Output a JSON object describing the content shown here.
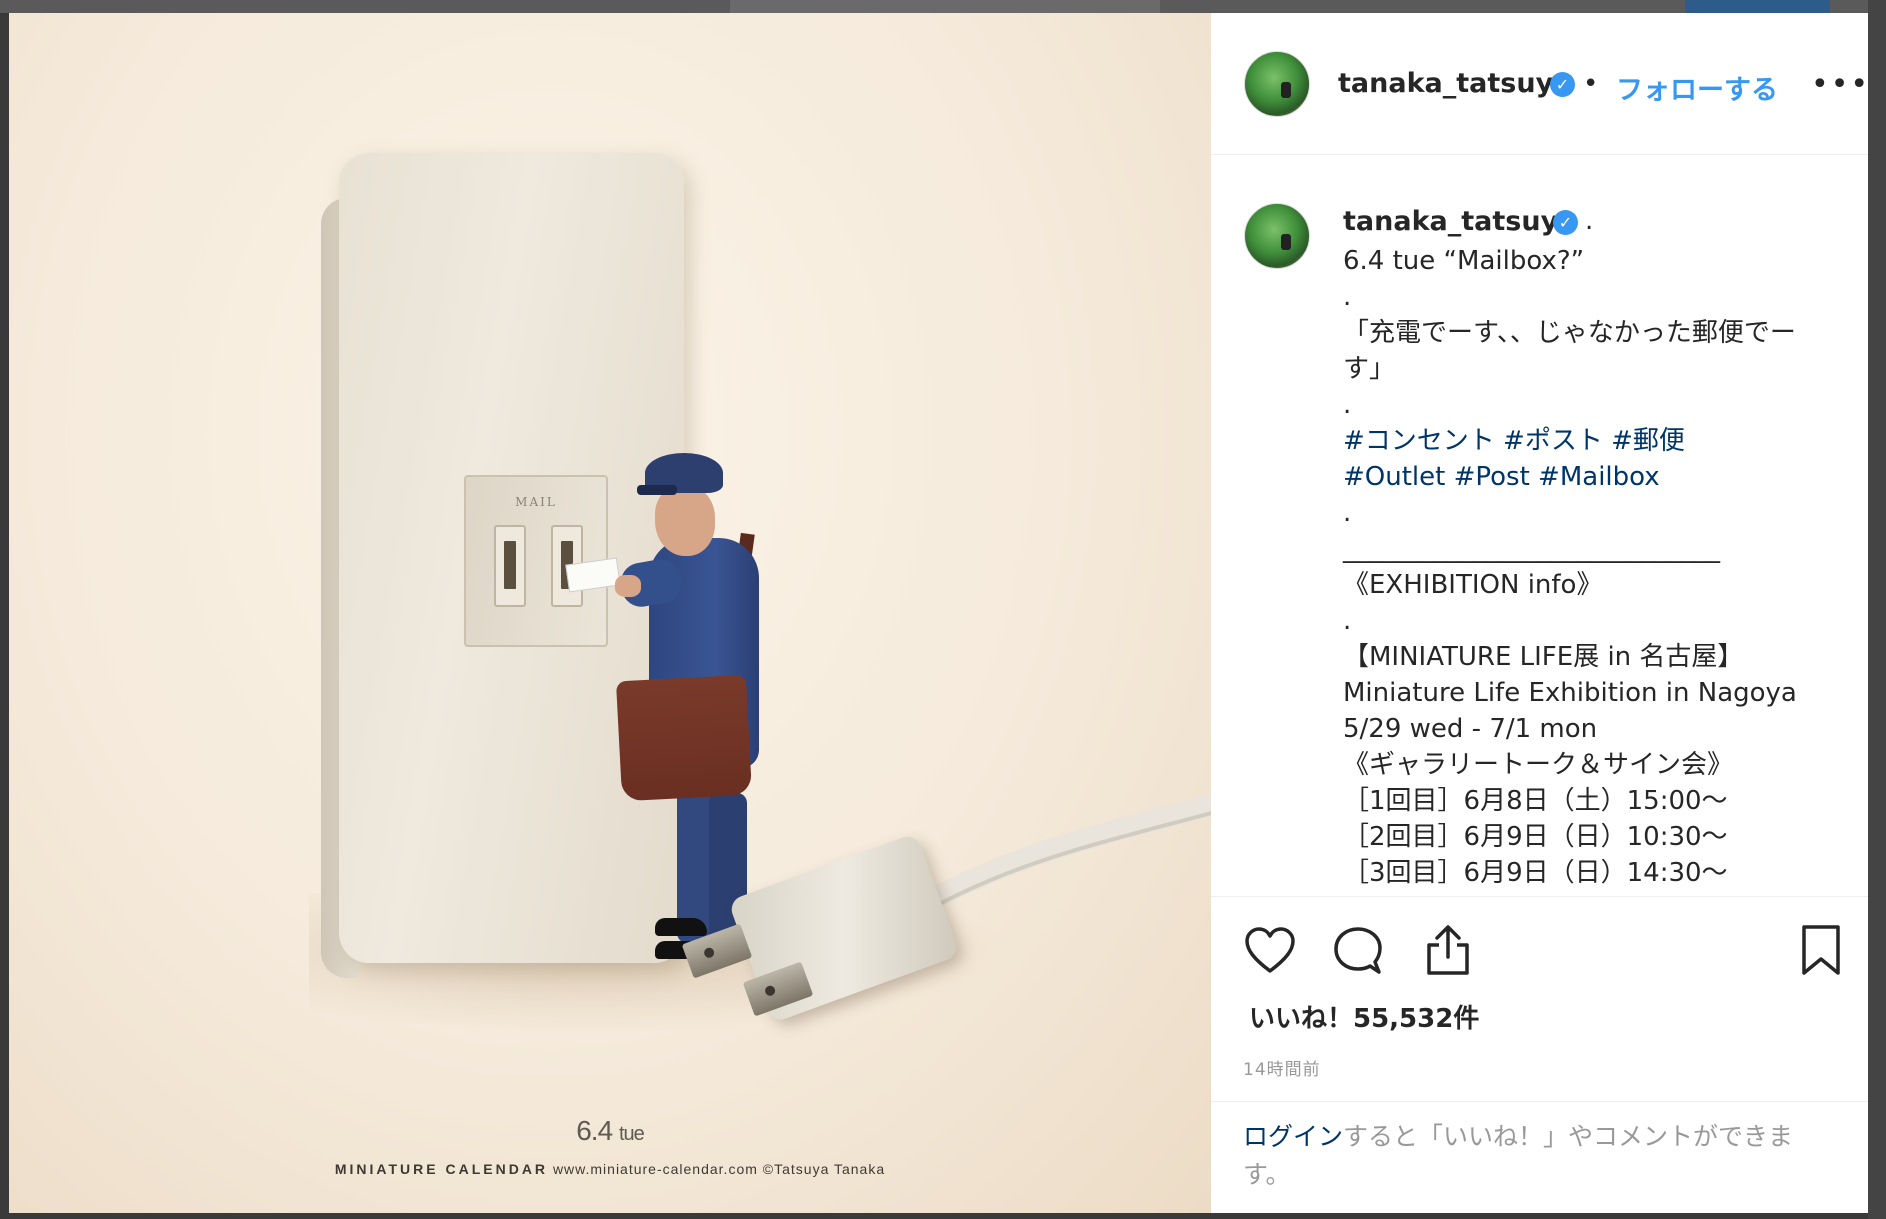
{
  "photo": {
    "outlet_label": "MAIL",
    "calendar_date": "6.4",
    "calendar_day": "tue",
    "calendar_brand": "MINIATURE CALENDAR",
    "calendar_credit": "www.miniature-calendar.com ©Tatsuya Tanaka"
  },
  "header": {
    "username": "tanaka_tatsuya",
    "separator": "•",
    "follow_label": "フォローする",
    "more_label": "•••"
  },
  "caption": {
    "username": "tanaka_tatsuya",
    "suffix": ".",
    "lines": [
      "6.4 tue “Mailbox?”",
      ".",
      "「充電でーす、、じゃなかった郵便でー",
      "す」",
      ".",
      "#コンセント #ポスト #郵便",
      "#Outlet #Post #Mailbox",
      ".",
      "_____________________________",
      "《EXHIBITION info》",
      ".",
      "【MINIATURE LIFE展 in 名古屋】",
      "Miniature Life Exhibition in Nagoya",
      "5/29 wed - 7/1 mon",
      "《ギャラリートーク＆サイン会》",
      "［1回目］6月8日（土）15:00〜",
      "［2回目］6月9日（日）10:30〜",
      "［3回目］6月9日（日）14:30〜"
    ]
  },
  "actions": {
    "like_icon": "heart-icon",
    "comment_icon": "comment-icon",
    "share_icon": "share-icon",
    "save_icon": "bookmark-icon"
  },
  "likes_text": "いいね！55,532件",
  "time_text": "14時間前",
  "login": {
    "link": "ログイン",
    "rest_line1": "すると「いいね！」やコメントができま",
    "rest_line2": "す。"
  },
  "colors": {
    "accent": "#3897f0",
    "hashtag": "#003569",
    "text": "#262626",
    "muted": "#999999"
  }
}
